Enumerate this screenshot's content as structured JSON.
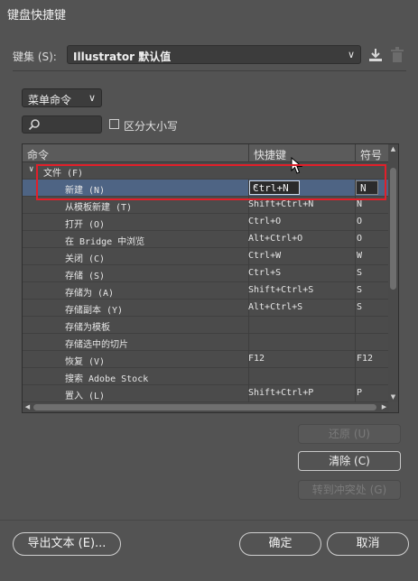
{
  "window": {
    "title": "键盘快捷键"
  },
  "keyset": {
    "label": "键集 (S):",
    "value": "Illustrator 默认值"
  },
  "icons": {
    "save": "save-keyset-icon",
    "delete": "trash-icon",
    "search": "search-icon"
  },
  "filter": {
    "category": "菜单命令",
    "search_value": "",
    "case_label": "区分大小写",
    "case_checked": false
  },
  "table": {
    "headers": {
      "command": "命令",
      "shortcut": "快捷键",
      "symbol": "符号"
    },
    "group": {
      "toggle": "∨",
      "label": "文件 (F)"
    },
    "rows": [
      {
        "command": "新建 (N)",
        "shortcut": "Ctrl+N",
        "symbol": "N"
      },
      {
        "command": "从模板新建 (T)",
        "shortcut": "Shift+Ctrl+N",
        "symbol": "N"
      },
      {
        "command": "打开 (O)",
        "shortcut": "Ctrl+O",
        "symbol": "O"
      },
      {
        "command": "在 Bridge 中浏览",
        "shortcut": "Alt+Ctrl+O",
        "symbol": "O"
      },
      {
        "command": "关闭 (C)",
        "shortcut": "Ctrl+W",
        "symbol": "W"
      },
      {
        "command": "存储 (S)",
        "shortcut": "Ctrl+S",
        "symbol": "S"
      },
      {
        "command": "存储为 (A)",
        "shortcut": "Shift+Ctrl+S",
        "symbol": "S"
      },
      {
        "command": "存储副本 (Y)",
        "shortcut": "Alt+Ctrl+S",
        "symbol": "S"
      },
      {
        "command": "存储为模板",
        "shortcut": "",
        "symbol": ""
      },
      {
        "command": "存储选中的切片",
        "shortcut": "",
        "symbol": ""
      },
      {
        "command": "恢复 (V)",
        "shortcut": "F12",
        "symbol": "F12"
      },
      {
        "command": "搜索 Adobe Stock",
        "shortcut": "",
        "symbol": ""
      },
      {
        "command": "置入 (L)",
        "shortcut": "Shift+Ctrl+P",
        "symbol": "P"
      }
    ],
    "editing": {
      "shortcut_value": "Ctrl+N",
      "clear_glyph": "×",
      "symbol_value": "N"
    },
    "scroll": {
      "up": "▲",
      "down": "▼",
      "left": "◀",
      "right": "▶"
    }
  },
  "buttons": {
    "undo": "还原 (U)",
    "clear": "清除 (C)",
    "goto_conflict": "转到冲突处 (G)",
    "export_text": "导出文本 (E)...",
    "ok": "确定",
    "cancel": "取消"
  },
  "colors": {
    "highlight_box": "#e11f2a",
    "selected_row": "#4e6484"
  }
}
